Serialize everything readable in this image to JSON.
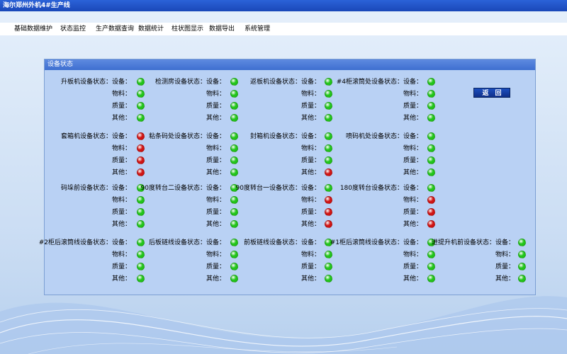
{
  "window": {
    "title": "海尔郑州外机4#生产线"
  },
  "menu": [
    "基础数据维护",
    "状态监控",
    "生产数据查询",
    "数据统计",
    "柱状图显示",
    "数据导出",
    "系统管理"
  ],
  "panel": {
    "title": "设备状态"
  },
  "return_button": "返　回",
  "colors": {
    "ok": "#22c51a",
    "fault": "#d01414"
  },
  "devices": [
    {
      "name": "升板机设备状态：",
      "status": [
        "ok",
        "ok",
        "ok",
        "ok"
      ]
    },
    {
      "name": "检测房设备状态：",
      "status": [
        "ok",
        "ok",
        "ok",
        "ok"
      ]
    },
    {
      "name": "返板机设备状态：",
      "status": [
        "ok",
        "ok",
        "ok",
        "ok"
      ]
    },
    {
      "name": "#4柜滚筒处设备状态：",
      "status": [
        "ok",
        "ok",
        "ok",
        "ok"
      ]
    },
    {
      "name": "套箱机设备状态：",
      "status": [
        "fault",
        "fault",
        "fault",
        "fault"
      ]
    },
    {
      "name": "粘条码处设备状态：",
      "status": [
        "ok",
        "ok",
        "ok",
        "ok"
      ]
    },
    {
      "name": "封箱机设备状态：",
      "status": [
        "ok",
        "ok",
        "ok",
        "fault"
      ]
    },
    {
      "name": "喷码机处设备状态：",
      "status": [
        "ok",
        "ok",
        "ok",
        "ok"
      ]
    },
    {
      "name": "码垛前设备状态：",
      "status": [
        "ok",
        "ok",
        "ok",
        "ok"
      ]
    },
    {
      "name": "90度转台二设备状态：",
      "status": [
        "ok",
        "ok",
        "ok",
        "ok"
      ]
    },
    {
      "name": "90度转台一设备状态：",
      "status": [
        "ok",
        "fault",
        "fault",
        "fault"
      ]
    },
    {
      "name": "180度转台设备状态：",
      "status": [
        "ok",
        "fault",
        "fault",
        "fault"
      ]
    },
    {
      "name": "#2柜后滚筒线设备状态：",
      "status": [
        "ok",
        "ok",
        "ok",
        "ok"
      ]
    },
    {
      "name": "后板链线设备状态：",
      "status": [
        "ok",
        "ok",
        "ok",
        "ok"
      ]
    },
    {
      "name": "前板链线设备状态：",
      "status": [
        "ok",
        "ok",
        "ok",
        "ok"
      ]
    },
    {
      "name": "#1柜后滚筒线设备状态：",
      "status": [
        "ok",
        "ok",
        "ok",
        "ok"
      ]
    },
    {
      "name": "进提升机前设备状态：",
      "status": [
        "ok",
        "ok",
        "ok",
        "ok"
      ]
    }
  ],
  "rows": [
    "设备：",
    "物料：",
    "质量：",
    "其他："
  ]
}
